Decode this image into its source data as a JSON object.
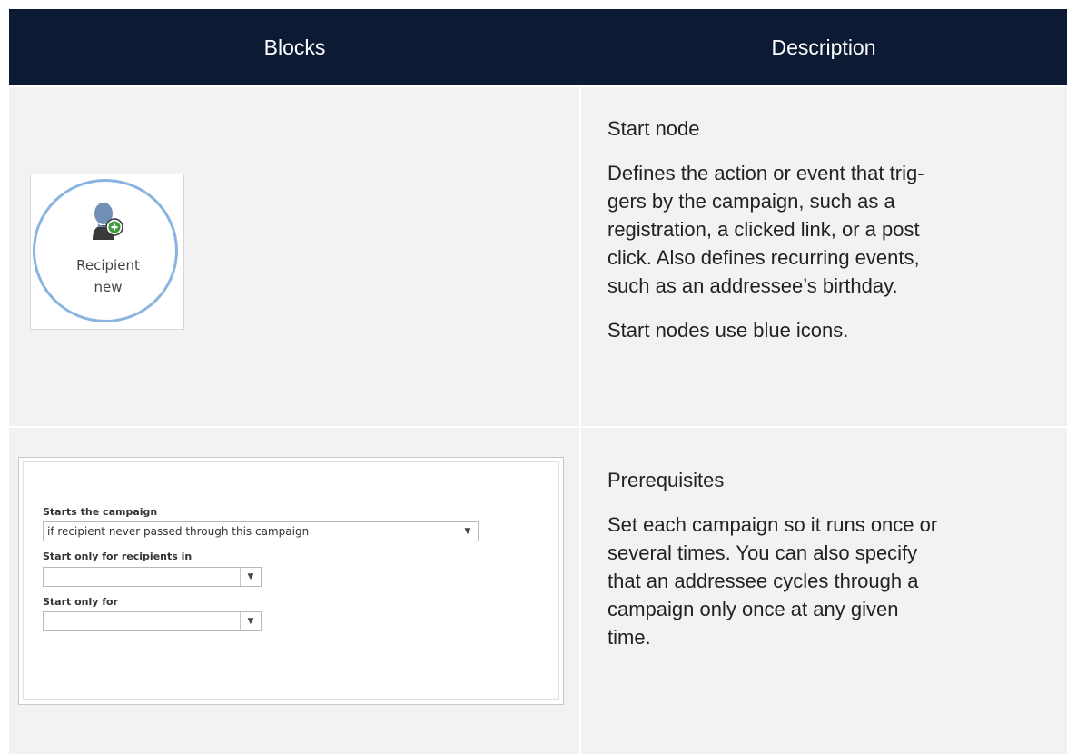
{
  "header": {
    "col_blocks": "Blocks",
    "col_description": "Description"
  },
  "rows": [
    {
      "block": {
        "node_label_line1": "Recipient",
        "node_label_line2": "new",
        "icon": "recipient-add-icon",
        "accent_color": "#8ab4e0"
      },
      "description": {
        "title": "Start node",
        "paragraph1_line1": "Defines the action or event that trig-",
        "paragraph1_line2": "gers by the campaign, such as a",
        "paragraph1_line3": "registration, a clicked link, or a post",
        "paragraph1_line4": "click. Also defines recurring events,",
        "paragraph1_line5": "such as an addressee’s birthday.",
        "paragraph2": "Start nodes use blue icons."
      }
    },
    {
      "block": {
        "form": {
          "field1_label": "Starts the campaign",
          "field1_value": "if recipient never passed through this campaign",
          "field2_label": "Start only for recipients in",
          "field2_value": "",
          "field3_label": "Start only for",
          "field3_value": ""
        }
      },
      "description": {
        "title": "Prerequisites",
        "paragraph1_line1": "Set each campaign so it runs once or",
        "paragraph1_line2": "several times. You can also specify",
        "paragraph1_line3": "that an addressee cycles through a",
        "paragraph1_line4": "campaign only once at any given",
        "paragraph1_line5": "time."
      }
    }
  ],
  "colors": {
    "header_bg": "#0c1a33",
    "row_bg": "#f2f2f2"
  }
}
